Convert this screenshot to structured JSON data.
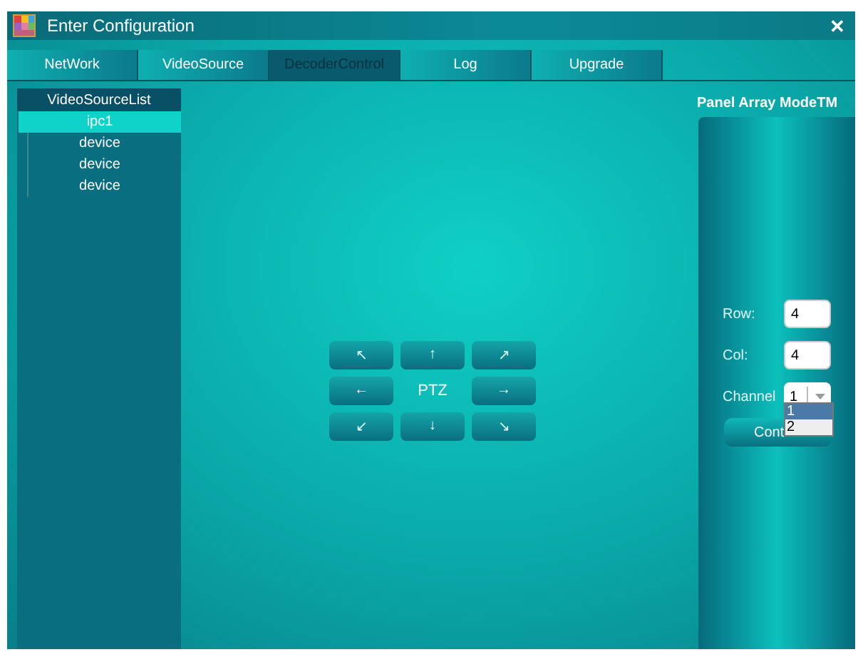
{
  "window": {
    "title": "Enter Configuration",
    "close": "✕"
  },
  "tabs": [
    {
      "label": "NetWork",
      "selected": false
    },
    {
      "label": "VideoSource",
      "selected": false
    },
    {
      "label": "DecoderControl",
      "selected": true
    },
    {
      "label": "Log",
      "selected": false
    },
    {
      "label": "Upgrade",
      "selected": false
    }
  ],
  "video_source_list": {
    "title": "VideoSourceList",
    "items": [
      {
        "label": "ipc1",
        "selected": true
      },
      {
        "label": "device",
        "selected": false
      },
      {
        "label": "device",
        "selected": false
      },
      {
        "label": "device",
        "selected": false
      }
    ]
  },
  "ptz": {
    "label": "PTZ",
    "buttons": [
      "↖",
      "↑",
      "↗",
      "←",
      "→",
      "↙",
      "↓",
      "↘"
    ]
  },
  "panel": {
    "title": "Panel Array ModeTM",
    "row_label": "Row:",
    "row_value": "4",
    "col_label": "Col:",
    "col_value": "4",
    "channel_label": "Channel",
    "channel_value": "1",
    "button": "Cont",
    "channel_options": [
      {
        "label": "1",
        "selected": true
      },
      {
        "label": "2",
        "selected": false
      }
    ]
  }
}
